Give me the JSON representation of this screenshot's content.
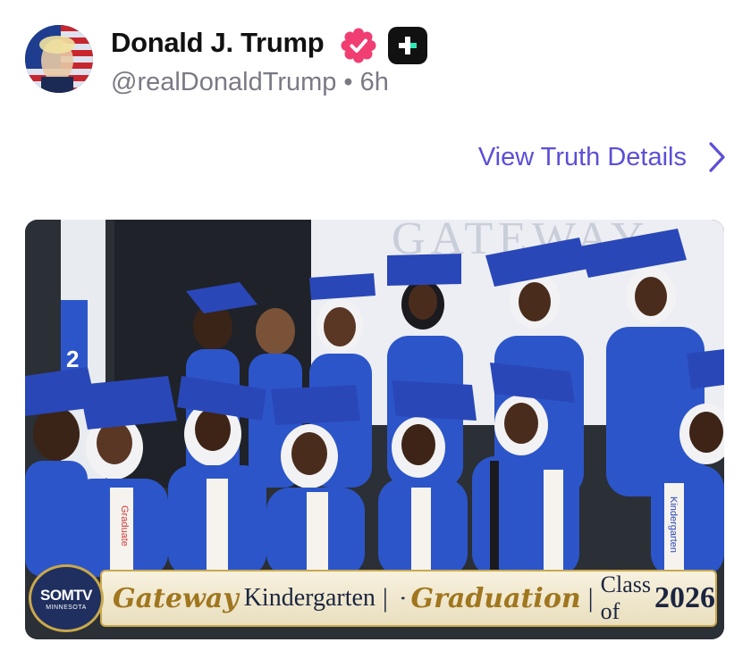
{
  "post": {
    "author_name": "Donald J. Trump",
    "handle": "@realDonaldTrump",
    "separator": "•",
    "time_ago": "6h",
    "view_details_label": "View Truth Details"
  },
  "media": {
    "backdrop_sign": "GATEWAY",
    "broadcaster": {
      "name": "SOMTV",
      "region": "MINNESOTA"
    },
    "banner": {
      "part1": "Gateway",
      "part2": "Kindergarten",
      "separator": "|",
      "part3": "Graduation",
      "class_label": "Class of",
      "year": "2026"
    },
    "stole_text": "Graduate",
    "stole_text_2": "Kindergarten",
    "flag_number": "2"
  },
  "colors": {
    "accent": "#5b4fd6",
    "verified": "#f03e73",
    "gown": "#2c55c9",
    "banner_gold": "#c9a84c"
  },
  "icons": {
    "verified": "verified-badge-icon",
    "plus": "plus-badge-icon",
    "chevron": "chevron-right-icon"
  }
}
